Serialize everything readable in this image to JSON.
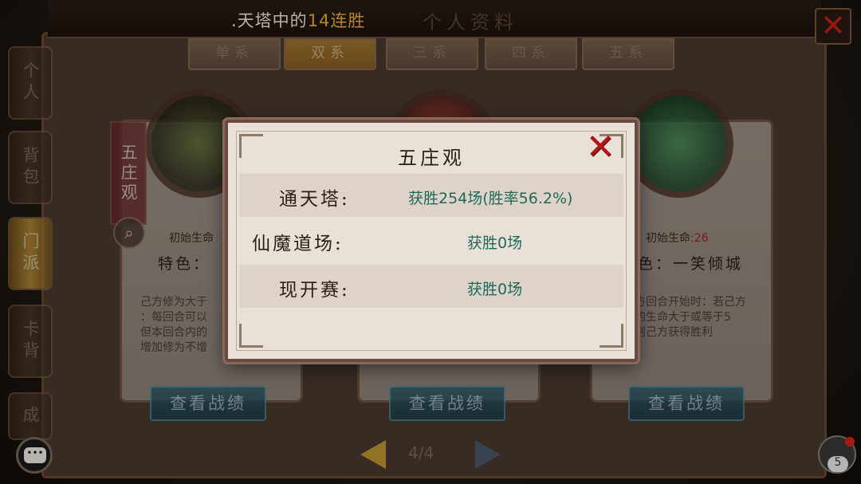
{
  "ticker": {
    "prefix": ".天塔中的",
    "highlight": "14连胜",
    "watermark": "个人资料"
  },
  "side_tabs": [
    {
      "label": "个人"
    },
    {
      "label": "背包"
    },
    {
      "label": "门派"
    },
    {
      "label": "卡背"
    },
    {
      "label": "成"
    }
  ],
  "top_tabs": [
    {
      "label": "单系"
    },
    {
      "label": "双系"
    },
    {
      "label": "三系"
    },
    {
      "label": "四系"
    },
    {
      "label": "五系"
    }
  ],
  "cards": [
    {
      "banner": "五庄观",
      "life_label": "初始生命",
      "feature": "特色：",
      "desc": "己方修为大于\n：每回合可以\n但本回合内的\n增加修为不增",
      "record": "查看战绩"
    },
    {
      "record": "查看战绩"
    },
    {
      "life_label": "初始生命",
      "life_value": ":26",
      "feature": "色：一笑倾城",
      "desc": "方回合开始时：若己方\n的生命大于或等于5\n则己方获得胜利",
      "record": "查看战绩"
    }
  ],
  "pager": {
    "text": "4/4"
  },
  "chat": {
    "icon": "chat-icon",
    "glyph": "•••"
  },
  "mail": {
    "count": "5"
  },
  "modal": {
    "title": "五庄观",
    "rows": [
      {
        "label": "通天塔:",
        "value": "获胜254场(胜率56.2%)"
      },
      {
        "label": "仙魔道场:",
        "value": "获胜0场"
      },
      {
        "label": "现开赛:",
        "value": "获胜0场"
      }
    ]
  },
  "colors": {
    "highlight": "#f0b23a",
    "stat_value": "#1f6a5a",
    "close": "#b01818"
  }
}
